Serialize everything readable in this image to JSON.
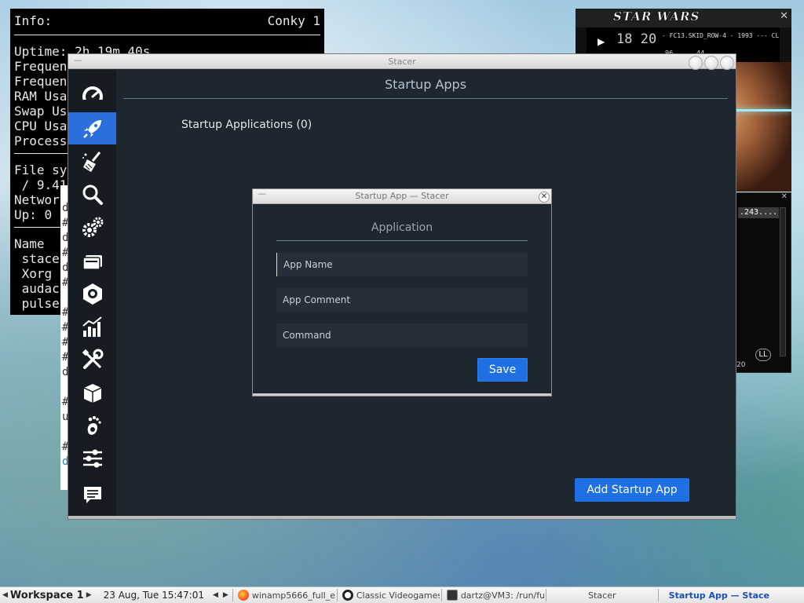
{
  "conky": {
    "info_label": "Info:",
    "app_name": "Conky 1",
    "lines_a": [
      "Uptime: 2h 19m 40s",
      "Frequen",
      "Frequen",
      "RAM Usa",
      "Swap Us",
      "CPU Usa",
      "Process"
    ],
    "lines_b": [
      "File sy",
      " / 9.41",
      "Networ",
      "Up: 0"
    ],
    "lines_c": [
      "Name",
      " stace",
      " Xorg",
      " audac",
      " pulse"
    ]
  },
  "terminal": {
    "lines": [
      "d",
      "#",
      "d",
      "#",
      "d",
      "#",
      "",
      "#",
      "#",
      "#",
      "#",
      "d",
      "",
      "#",
      "u",
      "",
      "#",
      "d"
    ]
  },
  "winamp": {
    "logo": "STAR WARS",
    "close": "✕",
    "play_symbol": "▶",
    "time": "18 20",
    "marquee": "- FC13.SKID_ROW-4 - 1993 --- CL",
    "kbps": "96",
    "khz": "44",
    "playlist_item": ".243....",
    "playlist_btn": "LL",
    "playlist_num": "20",
    "playlist_close": "✕"
  },
  "stacer": {
    "window_title": "Stacer",
    "page_title": "Startup Apps",
    "startup_count_label": "Startup Applications (0)",
    "add_button": "Add Startup App",
    "nav": [
      {
        "name": "dashboard",
        "icon": "speedometer-icon"
      },
      {
        "name": "startup-apps",
        "icon": "rocket-icon",
        "active": true
      },
      {
        "name": "system-cleaner",
        "icon": "broom-icon"
      },
      {
        "name": "search",
        "icon": "search-icon"
      },
      {
        "name": "services",
        "icon": "gears-icon"
      },
      {
        "name": "processes",
        "icon": "cards-icon"
      },
      {
        "name": "uninstaller",
        "icon": "package-icon"
      },
      {
        "name": "resources",
        "icon": "bar-chart-icon"
      },
      {
        "name": "helpers",
        "icon": "tools-icon"
      },
      {
        "name": "apt-repository",
        "icon": "box-icon"
      },
      {
        "name": "gnome-settings",
        "icon": "gnome-foot-icon"
      },
      {
        "name": "settings",
        "icon": "sliders-icon"
      },
      {
        "name": "feedback",
        "icon": "chat-icon"
      }
    ]
  },
  "dialog": {
    "title": "Startup App — Stacer",
    "heading": "Application",
    "app_name_placeholder": "App Name",
    "app_comment_placeholder": "App Comment",
    "command_placeholder": "Command",
    "save_button": "Save",
    "close_symbol": "✕",
    "min_symbol": "—"
  },
  "taskbar": {
    "workspace": "Workspace 1",
    "clock": "23 Aug, Tue 15:47:01",
    "tasks": [
      {
        "label": "winamp5666_full_e",
        "icon": "firefox-icon"
      },
      {
        "label": "Classic Videogames",
        "icon": "audacious-icon"
      },
      {
        "label": "dartz@VM3: /run/fu",
        "icon": "terminal-icon"
      },
      {
        "label": "Stacer",
        "icon": "stacer-icon"
      },
      {
        "label": "Startup App — Stace",
        "icon": "stacer-icon",
        "active": true
      }
    ]
  },
  "colors": {
    "accent": "#2a6fdb",
    "button_blue": "#1f6fe5",
    "window_bg": "#1e2630",
    "sidebar_bg": "#161c22"
  }
}
